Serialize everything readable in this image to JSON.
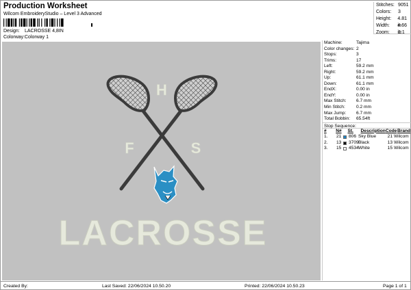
{
  "header": {
    "title": "Production Worksheet",
    "subtitle": "Wilcom EmbroideryStudio – Level 3 Advanced",
    "design_label": "Design:",
    "design_value": "LACROSSE 4,8IN",
    "colorway_label": "Colorway:",
    "colorway_value": "Colorway 1"
  },
  "top_stats": [
    {
      "label": "Stitches:",
      "value": "9051"
    },
    {
      "label": "Colors:",
      "value": "3"
    },
    {
      "label": "Height:",
      "value": "4.81 in"
    },
    {
      "label": "Width:",
      "value": "4.66 in"
    },
    {
      "label": "Zoom:",
      "value": "1:1"
    }
  ],
  "design": {
    "letters": [
      "H",
      "F",
      "S"
    ],
    "wordmark": "LACROSSE",
    "background_color": "#c1c1c1",
    "stick_color": "#3b3b3b",
    "lettering_color": "#e6e9dc",
    "mascot_color": "#2b8fc4"
  },
  "machine_info": [
    {
      "label": "Machine:",
      "value": "Tajima"
    },
    {
      "label": "Color changes:",
      "value": "2"
    },
    {
      "label": "Stops:",
      "value": "3"
    },
    {
      "label": "Trims:",
      "value": "17"
    },
    {
      "label": "Left:",
      "value": "59.2 mm"
    },
    {
      "label": "Right:",
      "value": "59.2 mm"
    },
    {
      "label": "Up:",
      "value": "61.1 mm"
    },
    {
      "label": "Down:",
      "value": "61.1 mm"
    },
    {
      "label": "EndX:",
      "value": "0.00 in"
    },
    {
      "label": "EndY:",
      "value": "0.00 in"
    },
    {
      "label": "Max Stitch:",
      "value": "6.7 mm"
    },
    {
      "label": "Min Stitch:",
      "value": "0.2 mm"
    },
    {
      "label": "Max Jump:",
      "value": "6.7 mm"
    },
    {
      "label": "Total Bobbin:",
      "value": "65.54ft"
    }
  ],
  "stop_sequence": {
    "title": "Stop Sequence:",
    "headers": [
      "#",
      "N#",
      "St.",
      "Description",
      "Code",
      "Brand"
    ],
    "rows": [
      {
        "index": "1.",
        "n": "21",
        "swatch": "#1f86c8",
        "code": "806",
        "description": "Sky Blue",
        "code2": "21",
        "brand": "Wilcom"
      },
      {
        "index": "2.",
        "n": "13",
        "swatch": "#111111",
        "code": "3709",
        "description": "Black",
        "code2": "13",
        "brand": "Wilcom"
      },
      {
        "index": "3.",
        "n": "15",
        "swatch": "#ffffff",
        "code": "4534",
        "description": "White",
        "code2": "15",
        "brand": "Wilcom"
      }
    ]
  },
  "footer": {
    "created_by": "Created By:",
    "last_saved": "Last Saved: 22/06/2024 10.50.20",
    "printed": "Printed: 22/06/2024 10.50.23",
    "page": "Page 1 of 1"
  }
}
